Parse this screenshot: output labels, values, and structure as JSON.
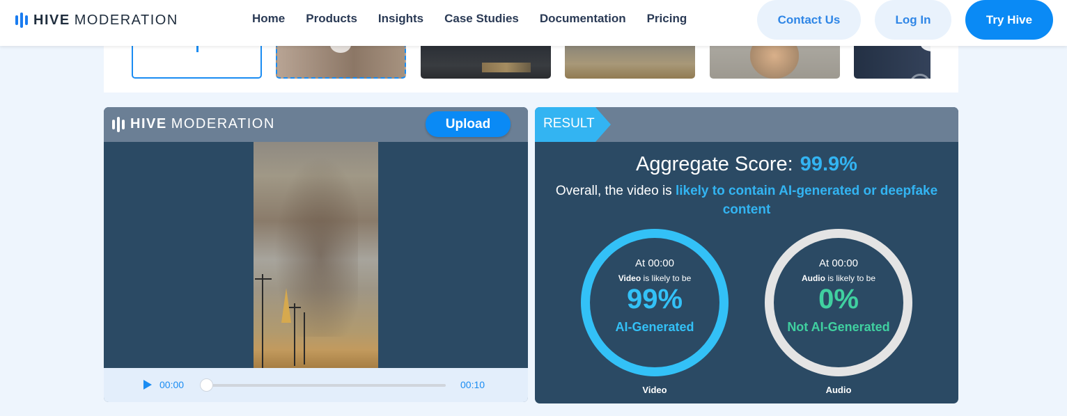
{
  "nav": {
    "brand_bold": "HIVE",
    "brand_light": "MODERATION",
    "links": [
      "Home",
      "Products",
      "Insights",
      "Case Studies",
      "Documentation",
      "Pricing"
    ],
    "contact_label": "Contact Us",
    "login_label": "Log In",
    "try_label": "Try Hive"
  },
  "upload_panel": {
    "brand_bold": "HIVE",
    "brand_light": "MODERATION",
    "upload_label": "Upload",
    "player": {
      "current_time": "00:00",
      "duration": "00:10",
      "progress": 0
    }
  },
  "result_panel": {
    "tag": "RESULT",
    "aggregate_label": "Aggregate Score:",
    "aggregate_score": "99.9%",
    "overall_prefix": "Overall, the video is",
    "overall_verdict": "likely to contain AI-generated or deepfake content",
    "gauges": [
      {
        "at": "At 00:00",
        "subject": "Video",
        "likely_text": "is likely to be",
        "percent": "99%",
        "label": "AI-Generated",
        "caption": "Video",
        "color": "#33c1f7"
      },
      {
        "at": "At 00:00",
        "subject": "Audio",
        "likely_text": "is likely to be",
        "percent": "0%",
        "label": "Not AI-Generated",
        "caption": "Audio",
        "color": "#40d0a0"
      }
    ]
  },
  "colors": {
    "accent": "#0a8af5",
    "panel": "#2b4a64",
    "panel_header": "#6b7f95",
    "highlight": "#33b4f2"
  }
}
